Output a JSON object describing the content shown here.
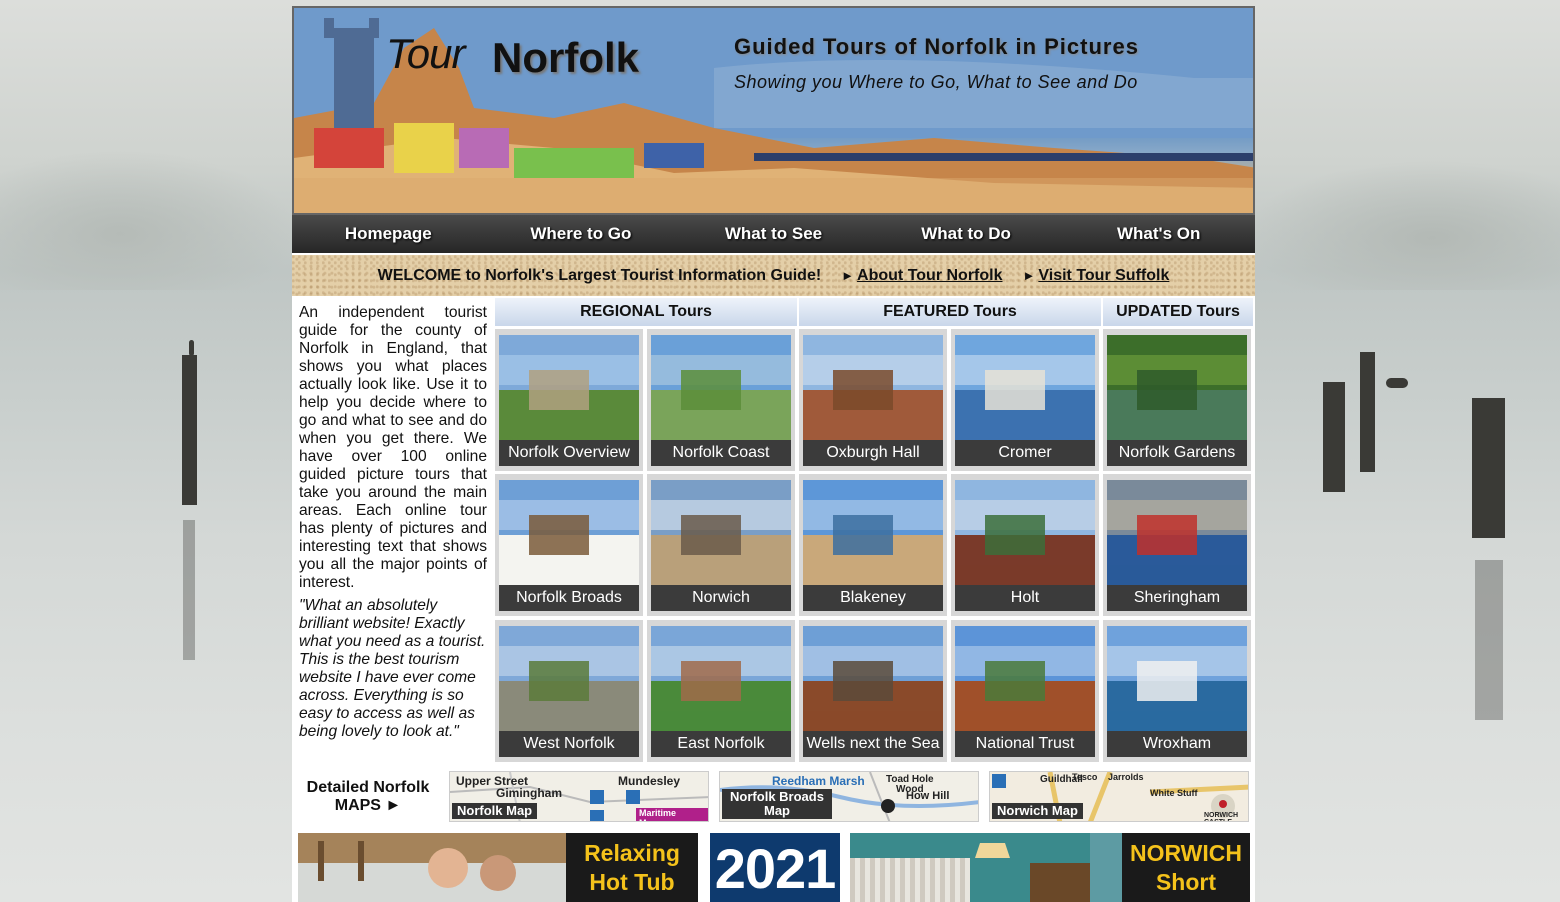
{
  "banner": {
    "logo_tour": "Tour",
    "logo_norfolk": "Norfolk",
    "title": "Guided Tours of Norfolk in Pictures",
    "subtitle": "Showing you Where to Go, What to See and Do"
  },
  "nav": [
    "Homepage",
    "Where to Go",
    "What to See",
    "What to Do",
    "What's On"
  ],
  "welcome": {
    "text": "WELCOME to Norfolk's Largest Tourist Information Guide!",
    "link1": "About Tour Norfolk",
    "link2": "Visit Tour Suffolk",
    "arrow": "►"
  },
  "intro": "An independent tourist guide for the county of Norfolk in England, that shows you what places actually look like. Use it to help you decide where to go and what to see and do when you get there. We have over 100 online guided picture tours that take you around the main areas. Each online tour has plenty of pictures and interesting text that shows you all the major points of interest.",
  "quote": "\"What an absolutely brilliant website! Exactly what you need as a tourist. This is the best tourism website I have ever come across. Everything is so easy to access as well as being lovely to look at.\"",
  "columns": {
    "regional": "REGIONAL Tours",
    "featured": "FEATURED Tours",
    "updated": "UPDATED Tours"
  },
  "tours": [
    [
      "Norfolk Overview",
      "Norfolk Coast",
      "Oxburgh Hall",
      "Cromer",
      "Norfolk Gardens"
    ],
    [
      "Norfolk Broads",
      "Norwich",
      "Blakeney",
      "Holt",
      "Sheringham"
    ],
    [
      "West Norfolk",
      "East Norfolk",
      "Wells next the Sea",
      "National Trust",
      "Wroxham"
    ]
  ],
  "maps": {
    "label": "Detailed Norfolk MAPS",
    "arrow": "►",
    "items": [
      {
        "tag": "Norfolk Map",
        "words": [
          "Upper Street",
          "Gimingham",
          "Mundesley",
          "Maritime Museum"
        ]
      },
      {
        "tag": "Norfolk Broads Map",
        "words": [
          "Reedham Marsh",
          "Toad Hole",
          "How Hill",
          "Wood"
        ]
      },
      {
        "tag": "Norwich Map",
        "words": [
          "Guildhall",
          "Tesco",
          "Jarrolds",
          "White Stuff",
          "NORWICH CASTLE"
        ]
      }
    ]
  },
  "ads": {
    "hot_tub": "Relaxing Hot Tub Breaks",
    "year": "2021",
    "norwich": "NORWICH Short Breaks"
  }
}
